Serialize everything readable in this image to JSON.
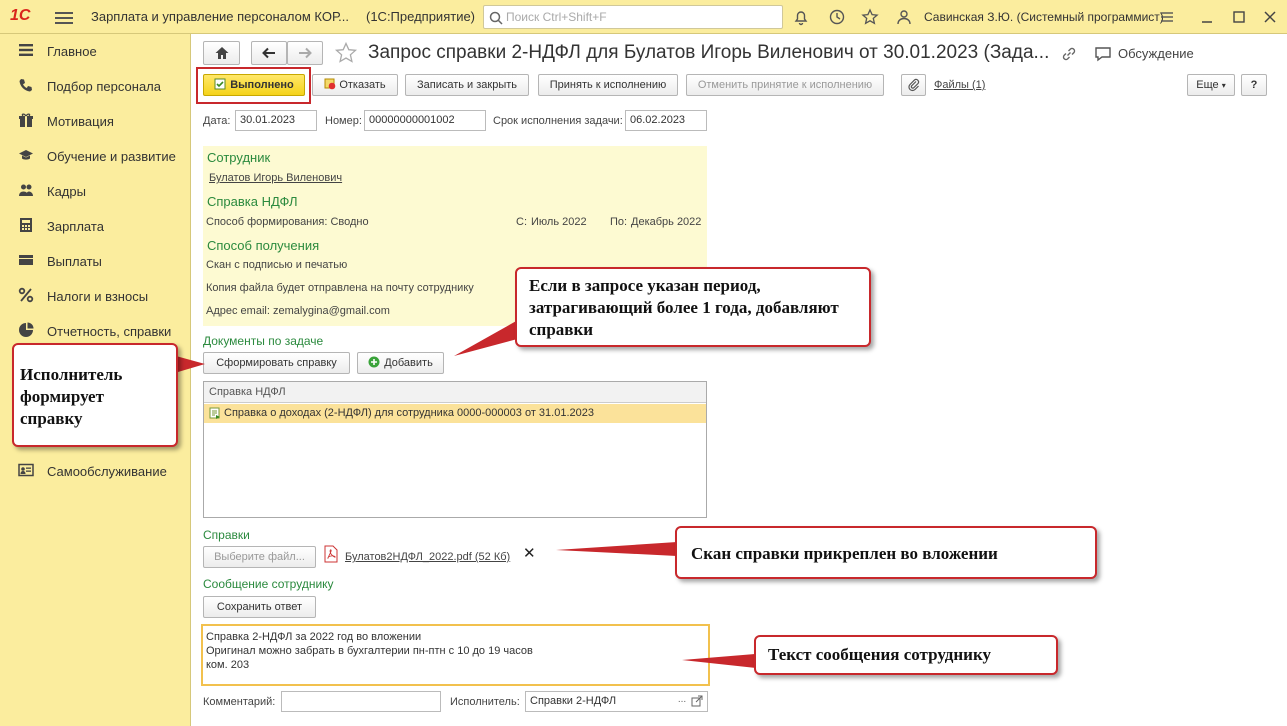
{
  "topbar": {
    "logo": "1С",
    "app_title": "Зарплата и управление персоналом КОР...",
    "app_sub": "(1С:Предприятие)",
    "search_placeholder": "Поиск Ctrl+Shift+F",
    "user": "Савинская З.Ю. (Системный программист)",
    "icons": [
      "bell-icon",
      "history-icon",
      "star-icon",
      "users-icon",
      "more-icon",
      "minimize-icon",
      "maximize-icon",
      "close-icon"
    ]
  },
  "sidebar": {
    "items": [
      {
        "label": "Главное",
        "icon": "menu-lines-icon"
      },
      {
        "label": "Подбор персонала",
        "icon": "phone-icon"
      },
      {
        "label": "Мотивация",
        "icon": "gift-icon"
      },
      {
        "label": "Обучение и развитие",
        "icon": "graduation-cap-icon"
      },
      {
        "label": "Кадры",
        "icon": "people-icon"
      },
      {
        "label": "Зарплата",
        "icon": "calculator-icon"
      },
      {
        "label": "Выплаты",
        "icon": "wallet-icon"
      },
      {
        "label": "Налоги и взносы",
        "icon": "percent-icon"
      },
      {
        "label": "Отчетность, справки",
        "icon": "chart-icon"
      },
      {
        "label": "Самообслуживание",
        "icon": "id-card-icon"
      }
    ]
  },
  "header": {
    "title": "Запрос справки 2-НДФЛ для Булатов Игорь Виленович от 30.01.2023 (Зада...",
    "discussion": "Обсуждение"
  },
  "toolbar": {
    "done": "Выполнено",
    "reject": "Отказать",
    "save_close": "Записать и закрыть",
    "accept": "Принять к исполнению",
    "cancel_accept": "Отменить принятие к исполнению",
    "files": "Файлы (1)",
    "more": "Еще",
    "help": "?"
  },
  "fields": {
    "date_label": "Дата:",
    "date_value": "30.01.2023",
    "number_label": "Номер:",
    "number_value": "00000000001002",
    "deadline_label": "Срок исполнения задачи:",
    "deadline_value": "06.02.2023"
  },
  "employee": {
    "section": "Сотрудник",
    "name": "Булатов Игорь Виленович"
  },
  "certificate": {
    "section": "Справка НДФЛ",
    "method": "Способ формирования: Сводно",
    "from_label": "С:",
    "from_value": "Июль 2022",
    "to_label": "По:",
    "to_value": "Декабрь 2022"
  },
  "delivery": {
    "section": "Способ получения",
    "line1": "Скан с подписью и печатью",
    "line2": "Копия файла будет отправлена на почту сотруднику",
    "email_label": "Адрес email:",
    "email": "zemalygina@gmail.com"
  },
  "docs": {
    "section": "Документы по задаче",
    "generate_btn": "Сформировать справку",
    "add_btn": "Добавить",
    "column": "Справка НДФЛ",
    "rows": [
      "Справка о доходах (2-НДФЛ) для сотрудника 0000-000003 от 31.01.2023"
    ]
  },
  "attachments": {
    "section": "Справки",
    "choose_btn": "Выберите файл...",
    "file": "Булатов2НДФЛ_2022.pdf (52 Кб)",
    "remove": "✕"
  },
  "message": {
    "section": "Сообщение сотруднику",
    "save_btn": "Сохранить ответ",
    "lines": [
      "Справка 2-НДФЛ за 2022 год во вложении",
      "Оригинал можно забрать в бухгалтерии пн-птн с 10 до 19 часов",
      "ком. 203"
    ]
  },
  "footer": {
    "comment_label": "Комментарий:",
    "comment_value": "",
    "executor_label": "Исполнитель:",
    "executor_value": "Справки 2-НДФЛ"
  },
  "callouts": {
    "period": "Если в запросе указан период, затрагивающий более 1 года, добавляют справки",
    "executor": "Исполнитель формирует справку",
    "scan": "Скан справки прикреплен во вложении",
    "text": "Текст сообщения сотруднику"
  },
  "colors": {
    "panel_yellow": "#fbed9e",
    "section_green": "#2b8a3e",
    "callout_red": "#c8282c",
    "link_blue": "#2a4ea8"
  }
}
